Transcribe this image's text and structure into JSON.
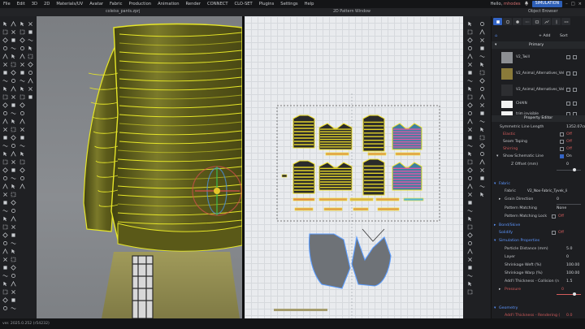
{
  "menu": {
    "items": [
      "File",
      "Edit",
      "3D",
      "2D",
      "Materials/UV",
      "Avatar",
      "Fabric",
      "Production",
      "Animation",
      "Render",
      "CONNECT",
      "CLO-SET",
      "Plugins",
      "Settings",
      "Help"
    ],
    "user_prefix": "Hello,",
    "user_name": "mhodes",
    "simulation_label": "SIMULATION"
  },
  "windows": {
    "file_title": "coleiss_pants.zprj",
    "pattern_window_title": "2D Pattern Window",
    "object_browser_title": "Object Browser"
  },
  "object_browser": {
    "add_label": "+ Add",
    "sort_label": "Sort",
    "section": "Primary",
    "fabrics": [
      {
        "name": "V2_Twill",
        "color": "#8d8f93"
      },
      {
        "name": "V2_Animal_Alternatives_Vel",
        "color": "#8a7a3a"
      },
      {
        "name": "V2_Animal_Alternatives_Vel",
        "color": "#2d2e31"
      },
      {
        "name": "CHAIN",
        "color": "#f2f2f2"
      },
      {
        "name": "trim invisible",
        "color": "#f2f2f2"
      }
    ]
  },
  "property_editor": {
    "title": "Property Editor",
    "symmetric_line_length_label": "Symmetric Line Length",
    "symmetric_line_length_value": "1352.07cm",
    "elastic_label": "Elastic",
    "elastic_value": "Off",
    "seam_taping_label": "Seam Taping",
    "seam_taping_value": "Off",
    "shirring_label": "Shirring",
    "shirring_value": "Off",
    "show_schematic_label": "Show Schematic Line",
    "show_schematic_value": "On",
    "z_offset_label": "Z Offset (mm)",
    "z_offset_value": "0",
    "fabric_section": "Fabric",
    "fabric_label": "Fabric",
    "fabric_value": "V2_Nox-Fabric_Tyvek_li",
    "grain_label": "Grain Direction",
    "grain_value": "0",
    "pattern_matching_label": "Pattern Matching",
    "pattern_matching_value": "None",
    "pattern_matching_lock_label": "Pattern Matching Lock",
    "pattern_matching_lock_value": "Off",
    "bond_section": "Bond/Skive",
    "solidify_label": "Solidify",
    "solidify_value": "Off",
    "sim_section": "Simulation Properties",
    "particle_label": "Particle Distance (mm)",
    "particle_value": "5.0",
    "layer_label": "Layer",
    "layer_value": "0",
    "shrink_weft_label": "Shrinkage Weft (%)",
    "shrink_weft_value": "100.00",
    "shrink_warp_label": "Shrinkage Warp (%)",
    "shrink_warp_value": "100.00",
    "addl_thickness_label": "Add'l Thickness - Collision (n",
    "addl_thickness_value": "1.5",
    "pressure_label": "Pressure",
    "pressure_value": "0",
    "geometry_section": "Geometry",
    "addl_render_label": "Add'l Thickness - Rendering (",
    "addl_render_value": "0.0"
  },
  "status": {
    "version": "ver. 2025.0.252 (r54232)"
  },
  "colors": {
    "accent": "#3465c6",
    "highlight": "#e8e82a",
    "jacket": "#6b6a1f",
    "off_red": "#d45c5c"
  }
}
